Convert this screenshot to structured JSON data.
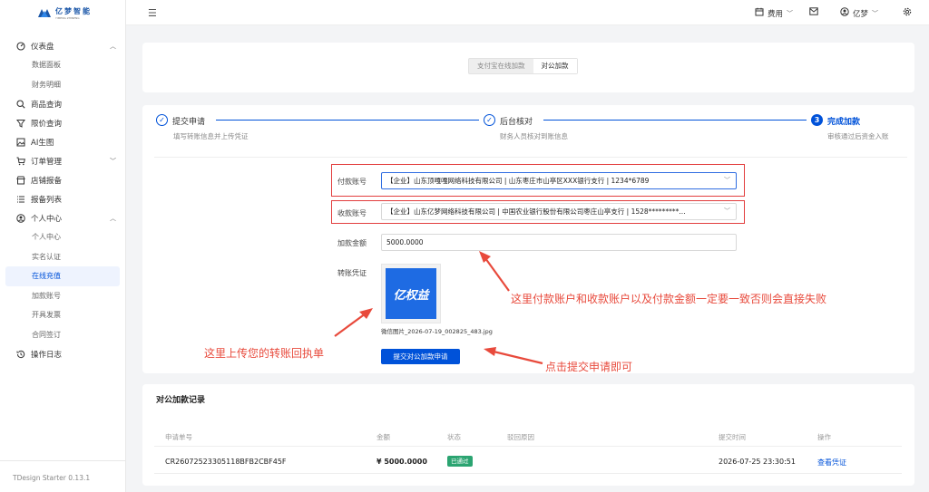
{
  "brand": {
    "name": "亿梦智能",
    "sub": "YIMENG ZHINENG"
  },
  "sidebar": {
    "groups": [
      {
        "label": "仪表盘",
        "icon": "dashboard-icon",
        "expanded": true,
        "children": [
          "数据面板",
          "财务明细"
        ]
      },
      {
        "label": "商品查询",
        "icon": "search-icon"
      },
      {
        "label": "限价查询",
        "icon": "filter-icon"
      },
      {
        "label": "AI生图",
        "icon": "image-icon"
      },
      {
        "label": "订单管理",
        "icon": "cart-icon",
        "expanded": false
      },
      {
        "label": "店铺报备",
        "icon": "shop-icon"
      },
      {
        "label": "报备列表",
        "icon": "list-icon"
      },
      {
        "label": "个人中心",
        "icon": "user-icon",
        "expanded": true,
        "children": [
          "个人中心",
          "实名认证",
          "在线充值",
          "加款账号",
          "开具发票",
          "合同签订"
        ]
      },
      {
        "label": "操作日志",
        "icon": "history-icon"
      }
    ],
    "active": "在线充值",
    "version": "TDesign Starter 0.13.1"
  },
  "header": {
    "fee_label": "费用",
    "user_label": "亿梦"
  },
  "mode_tabs": [
    "支付宝在线加款",
    "对公加款"
  ],
  "mode_selected": "对公加款",
  "steps": [
    {
      "title": "提交申请",
      "desc": "填写转账信息并上传凭证",
      "state": "done"
    },
    {
      "title": "后台核对",
      "desc": "财务人员核对到账信息",
      "state": "done"
    },
    {
      "title": "完成加款",
      "desc": "审核通过后资金入账",
      "state": "current",
      "number": "3"
    }
  ],
  "form": {
    "payer_label": "付款账号",
    "payer_value": "【企业】山东顶嘎嘎网络科技有限公司 | 山东枣庄市山亭区XXX银行支行 | 1234*6789",
    "payee_label": "收款账号",
    "payee_value": "【企业】山东亿梦网络科技有限公司 | 中国农业银行股份有限公司枣庄山亭支行 | 1528*********...",
    "amount_label": "加款金额",
    "amount_value": "5000.0000",
    "voucher_label": "转账凭证",
    "voucher_image_text": "亿权益",
    "voucher_filename": "微信图片_2026-07-19_002825_483.jpg",
    "submit_label": "提交对公加款申请"
  },
  "annotations": {
    "consistency": "这里付款账户和收款账户以及付款金额一定要一致否则会直接失败",
    "upload": "这里上传您的转账回执单",
    "submit": "点击提交申请即可"
  },
  "records": {
    "title": "对公加款记录",
    "columns": [
      "申请单号",
      "金额",
      "状态",
      "驳回原因",
      "提交时间",
      "操作"
    ],
    "rows": [
      {
        "id": "CR26072523305118BFB2CBF45F",
        "amount": "¥ 5000.0000",
        "status": "已通过",
        "reason": "",
        "time": "2026-07-25 23:30:51",
        "action": "查看凭证"
      }
    ]
  },
  "colors": {
    "primary": "#0052d9",
    "annotation": "#e84a3c",
    "success": "#2ba471"
  }
}
